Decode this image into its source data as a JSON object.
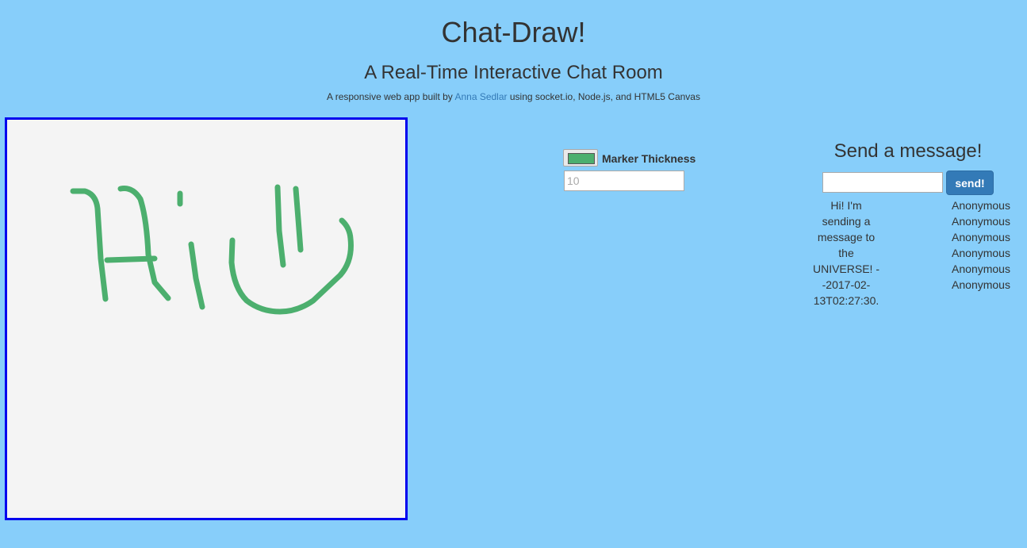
{
  "header": {
    "title": "Chat-Draw!",
    "subtitle": "A Real-Time Interactive Chat Room",
    "byline_prefix": "A responsive web app built by ",
    "author_link": "Anna Sedlar",
    "byline_suffix": " using socket.io, Node.js, and HTML5 Canvas"
  },
  "canvas": {
    "border_color": "#0000ee",
    "background": "#f4f4f4",
    "stroke_color": "#4caf6e"
  },
  "controls": {
    "marker_color": "#4caf6e",
    "thickness_label": "Marker Thickness",
    "thickness_placeholder": "10"
  },
  "chat": {
    "title": "Send a message!",
    "input_value": "",
    "send_label": "send!",
    "message_text": "Hi! I'm sending a message to the UNIVERSE! --2017-02-13T02:27:30.2",
    "authors": [
      "Anonymous",
      "Anonymous",
      "Anonymous",
      "Anonymous",
      "Anonymous",
      "Anonymous"
    ]
  },
  "colors": {
    "page_background": "#87cefa",
    "button_primary": "#337ab7",
    "link": "#337ab7"
  }
}
